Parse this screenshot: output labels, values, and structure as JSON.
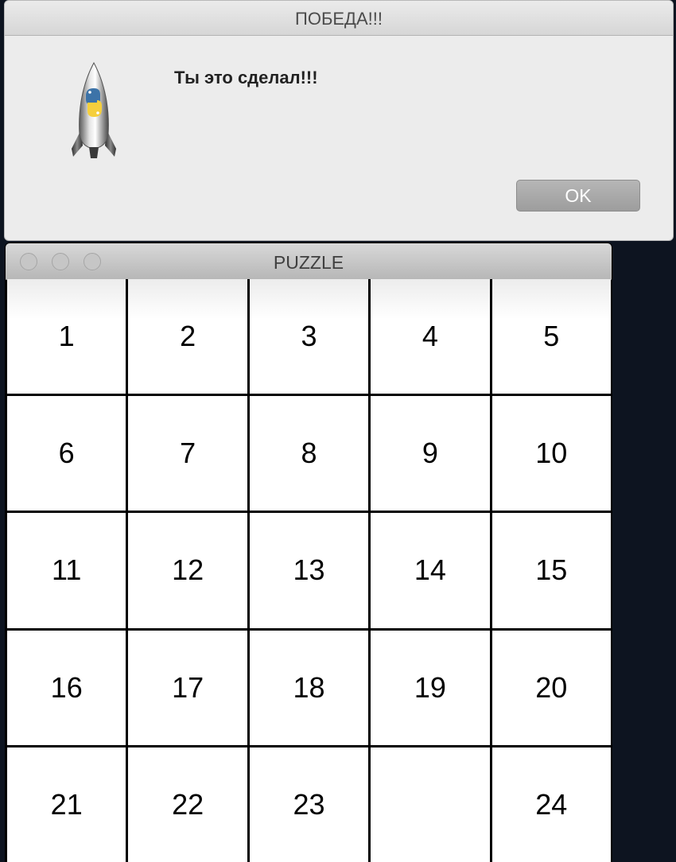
{
  "dialog": {
    "title": "ПОБЕДА!!!",
    "message": "Ты это сделал!!!",
    "ok_label": "OK",
    "icon": "python-rocket-icon"
  },
  "puzzle_window": {
    "title": "PUZZLE",
    "tiles": [
      [
        "1",
        "2",
        "3",
        "4",
        "5"
      ],
      [
        "6",
        "7",
        "8",
        "9",
        "10"
      ],
      [
        "11",
        "12",
        "13",
        "14",
        "15"
      ],
      [
        "16",
        "17",
        "18",
        "19",
        "20"
      ],
      [
        "21",
        "22",
        "23",
        "",
        "24"
      ]
    ]
  }
}
